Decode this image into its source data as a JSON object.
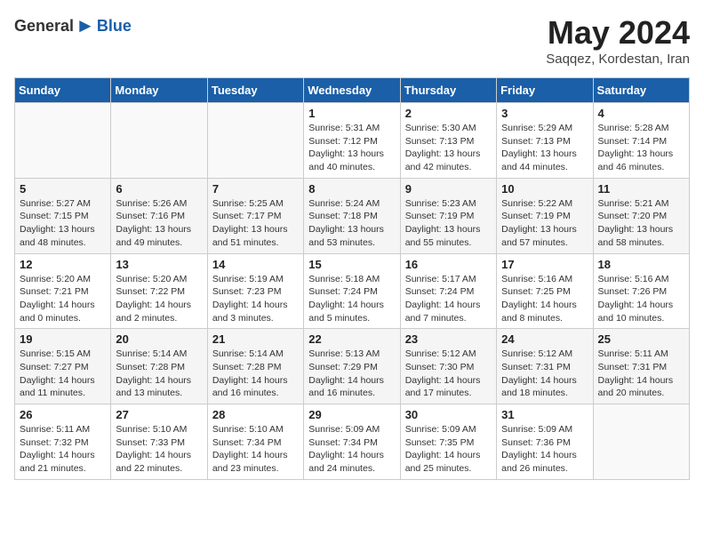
{
  "header": {
    "logo_general": "General",
    "logo_blue": "Blue",
    "month_year": "May 2024",
    "location": "Saqqez, Kordestan, Iran"
  },
  "weekdays": [
    "Sunday",
    "Monday",
    "Tuesday",
    "Wednesday",
    "Thursday",
    "Friday",
    "Saturday"
  ],
  "weeks": [
    [
      {
        "day": "",
        "info": ""
      },
      {
        "day": "",
        "info": ""
      },
      {
        "day": "",
        "info": ""
      },
      {
        "day": "1",
        "info": "Sunrise: 5:31 AM\nSunset: 7:12 PM\nDaylight: 13 hours\nand 40 minutes."
      },
      {
        "day": "2",
        "info": "Sunrise: 5:30 AM\nSunset: 7:13 PM\nDaylight: 13 hours\nand 42 minutes."
      },
      {
        "day": "3",
        "info": "Sunrise: 5:29 AM\nSunset: 7:13 PM\nDaylight: 13 hours\nand 44 minutes."
      },
      {
        "day": "4",
        "info": "Sunrise: 5:28 AM\nSunset: 7:14 PM\nDaylight: 13 hours\nand 46 minutes."
      }
    ],
    [
      {
        "day": "5",
        "info": "Sunrise: 5:27 AM\nSunset: 7:15 PM\nDaylight: 13 hours\nand 48 minutes."
      },
      {
        "day": "6",
        "info": "Sunrise: 5:26 AM\nSunset: 7:16 PM\nDaylight: 13 hours\nand 49 minutes."
      },
      {
        "day": "7",
        "info": "Sunrise: 5:25 AM\nSunset: 7:17 PM\nDaylight: 13 hours\nand 51 minutes."
      },
      {
        "day": "8",
        "info": "Sunrise: 5:24 AM\nSunset: 7:18 PM\nDaylight: 13 hours\nand 53 minutes."
      },
      {
        "day": "9",
        "info": "Sunrise: 5:23 AM\nSunset: 7:19 PM\nDaylight: 13 hours\nand 55 minutes."
      },
      {
        "day": "10",
        "info": "Sunrise: 5:22 AM\nSunset: 7:19 PM\nDaylight: 13 hours\nand 57 minutes."
      },
      {
        "day": "11",
        "info": "Sunrise: 5:21 AM\nSunset: 7:20 PM\nDaylight: 13 hours\nand 58 minutes."
      }
    ],
    [
      {
        "day": "12",
        "info": "Sunrise: 5:20 AM\nSunset: 7:21 PM\nDaylight: 14 hours\nand 0 minutes."
      },
      {
        "day": "13",
        "info": "Sunrise: 5:20 AM\nSunset: 7:22 PM\nDaylight: 14 hours\nand 2 minutes."
      },
      {
        "day": "14",
        "info": "Sunrise: 5:19 AM\nSunset: 7:23 PM\nDaylight: 14 hours\nand 3 minutes."
      },
      {
        "day": "15",
        "info": "Sunrise: 5:18 AM\nSunset: 7:24 PM\nDaylight: 14 hours\nand 5 minutes."
      },
      {
        "day": "16",
        "info": "Sunrise: 5:17 AM\nSunset: 7:24 PM\nDaylight: 14 hours\nand 7 minutes."
      },
      {
        "day": "17",
        "info": "Sunrise: 5:16 AM\nSunset: 7:25 PM\nDaylight: 14 hours\nand 8 minutes."
      },
      {
        "day": "18",
        "info": "Sunrise: 5:16 AM\nSunset: 7:26 PM\nDaylight: 14 hours\nand 10 minutes."
      }
    ],
    [
      {
        "day": "19",
        "info": "Sunrise: 5:15 AM\nSunset: 7:27 PM\nDaylight: 14 hours\nand 11 minutes."
      },
      {
        "day": "20",
        "info": "Sunrise: 5:14 AM\nSunset: 7:28 PM\nDaylight: 14 hours\nand 13 minutes."
      },
      {
        "day": "21",
        "info": "Sunrise: 5:14 AM\nSunset: 7:28 PM\nDaylight: 14 hours\nand 16 minutes."
      },
      {
        "day": "22",
        "info": "Sunrise: 5:13 AM\nSunset: 7:29 PM\nDaylight: 14 hours\nand 16 minutes."
      },
      {
        "day": "23",
        "info": "Sunrise: 5:12 AM\nSunset: 7:30 PM\nDaylight: 14 hours\nand 17 minutes."
      },
      {
        "day": "24",
        "info": "Sunrise: 5:12 AM\nSunset: 7:31 PM\nDaylight: 14 hours\nand 18 minutes."
      },
      {
        "day": "25",
        "info": "Sunrise: 5:11 AM\nSunset: 7:31 PM\nDaylight: 14 hours\nand 20 minutes."
      }
    ],
    [
      {
        "day": "26",
        "info": "Sunrise: 5:11 AM\nSunset: 7:32 PM\nDaylight: 14 hours\nand 21 minutes."
      },
      {
        "day": "27",
        "info": "Sunrise: 5:10 AM\nSunset: 7:33 PM\nDaylight: 14 hours\nand 22 minutes."
      },
      {
        "day": "28",
        "info": "Sunrise: 5:10 AM\nSunset: 7:34 PM\nDaylight: 14 hours\nand 23 minutes."
      },
      {
        "day": "29",
        "info": "Sunrise: 5:09 AM\nSunset: 7:34 PM\nDaylight: 14 hours\nand 24 minutes."
      },
      {
        "day": "30",
        "info": "Sunrise: 5:09 AM\nSunset: 7:35 PM\nDaylight: 14 hours\nand 25 minutes."
      },
      {
        "day": "31",
        "info": "Sunrise: 5:09 AM\nSunset: 7:36 PM\nDaylight: 14 hours\nand 26 minutes."
      },
      {
        "day": "",
        "info": ""
      }
    ]
  ]
}
